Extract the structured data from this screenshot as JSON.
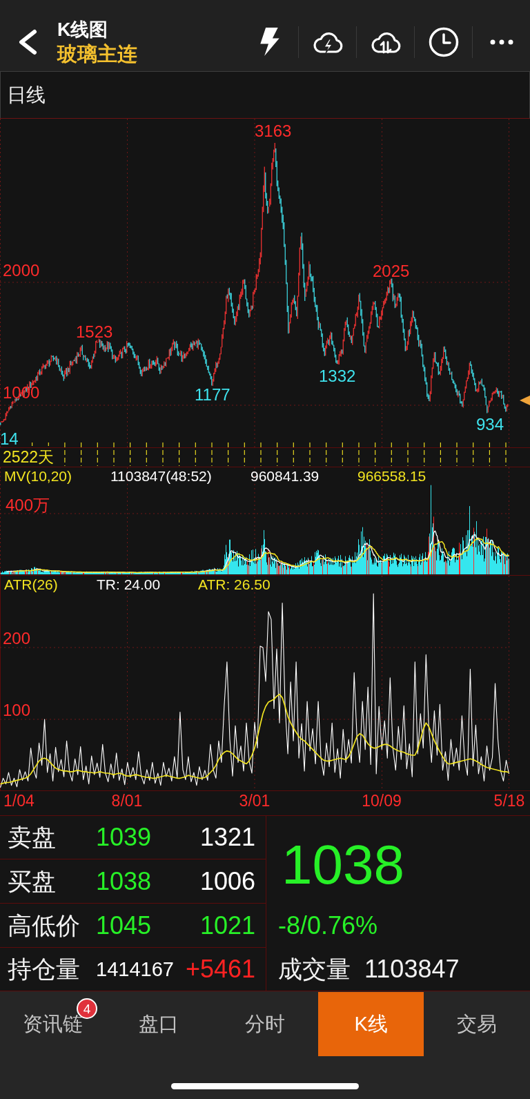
{
  "header": {
    "title": "K线图",
    "subtitle": "玻璃主连"
  },
  "period": {
    "label": "日线"
  },
  "price_chart": {
    "axis_labels": [
      "2000",
      "1000"
    ],
    "extremes": [
      {
        "text": "3163",
        "kind": "high"
      },
      {
        "text": "1523",
        "kind": "high"
      },
      {
        "text": "2025",
        "kind": "high"
      },
      {
        "text": "1177",
        "kind": "low"
      },
      {
        "text": "1332",
        "kind": "low"
      },
      {
        "text": "934",
        "kind": "low"
      },
      {
        "text": "14",
        "kind": "low"
      }
    ],
    "day_count": "2522天"
  },
  "volume_chart": {
    "legend": [
      {
        "text": "MV(10,20)",
        "color": "#f2e421"
      },
      {
        "text": "1103847(48:52)",
        "color": "#ffffff"
      },
      {
        "text": "960841.39",
        "color": "#ffffff"
      },
      {
        "text": "966558.15",
        "color": "#f2e421"
      }
    ],
    "axis_label": "400万"
  },
  "atr_chart": {
    "chart_data": {
      "type": "line",
      "title": "ATR(26)",
      "ylim": [
        0,
        300
      ],
      "yticks": [
        100,
        200
      ],
      "series": [
        {
          "name": "TR: 24.00",
          "color": "#ffffff",
          "values": [
            5,
            18,
            10,
            26,
            8,
            18,
            6,
            30,
            15,
            27,
            14,
            60,
            30,
            18,
            67,
            36,
            100,
            26,
            52,
            14,
            61,
            27,
            44,
            20,
            70,
            27,
            14,
            45,
            23,
            62,
            16,
            35,
            10,
            49,
            23,
            39,
            19,
            65,
            25,
            13,
            38,
            18,
            53,
            15,
            31,
            9,
            40,
            19,
            33,
            16,
            55,
            21,
            10,
            30,
            15,
            40,
            11,
            25,
            8,
            40,
            20,
            32,
            14,
            48,
            18,
            110,
            30,
            16,
            48,
            13,
            26,
            8,
            34,
            16,
            29,
            15,
            65,
            30,
            18,
            70,
            40,
            119,
            180,
            72,
            21,
            91,
            40,
            63,
            28,
            95,
            42,
            25,
            96,
            60,
            202,
            200,
            153,
            250,
            239,
            115,
            198,
            95,
            262,
            118,
            52,
            152,
            70,
            180,
            46,
            94,
            28,
            125,
            56,
            87,
            38,
            125,
            46,
            22,
            67,
            34,
            95,
            26,
            59,
            18,
            86,
            40,
            72,
            39,
            165,
            76,
            40,
            125,
            58,
            145,
            37,
            275,
            24,
            118,
            58,
            98,
            46,
            158,
            60,
            29,
            90,
            44,
            119,
            31,
            66,
            20,
            180,
            52,
            108,
            60,
            190,
            90,
            40,
            112,
            50,
            121,
            29,
            55,
            15,
            72,
            35,
            60,
            29,
            105,
            43,
            22,
            170,
            35,
            92,
            24,
            48,
            14,
            63,
            29,
            47,
            150,
            72,
            28,
            14,
            43,
            24
          ]
        },
        {
          "name": "ATR: 26.50",
          "color": "#f2e421",
          "values": [
            10,
            11,
            12,
            12,
            13,
            14,
            15,
            16,
            17,
            18,
            20,
            24,
            30,
            36,
            42,
            45,
            46,
            44,
            40,
            36,
            32,
            30,
            29,
            28,
            28,
            27,
            27,
            28,
            29,
            28,
            27,
            27,
            26,
            26,
            25,
            26,
            27,
            26,
            25,
            25,
            24,
            23,
            24,
            25,
            24,
            22,
            21,
            21,
            22,
            23,
            22,
            21,
            20,
            19,
            19,
            18,
            18,
            19,
            20,
            21,
            22,
            21,
            20,
            19,
            18,
            18,
            19,
            20,
            22,
            21,
            20,
            19,
            18,
            18,
            19,
            22,
            26,
            30,
            36,
            44,
            50,
            54,
            56,
            55,
            52,
            48,
            44,
            42,
            40,
            38,
            42,
            50,
            60,
            75,
            92,
            108,
            118,
            124,
            126,
            128,
            132,
            135,
            130,
            118,
            104,
            95,
            88,
            82,
            76,
            72,
            70,
            66,
            62,
            58,
            54,
            50,
            46,
            43,
            42,
            42,
            43,
            44,
            45,
            46,
            45,
            44,
            48,
            56,
            66,
            76,
            80,
            78,
            72,
            66,
            62,
            60,
            60,
            62,
            64,
            65,
            65,
            63,
            60,
            58,
            56,
            55,
            54,
            52,
            51,
            50,
            50,
            58,
            72,
            86,
            95,
            90,
            80,
            70,
            62,
            55,
            48,
            42,
            38,
            38,
            39,
            40,
            41,
            42,
            43,
            44,
            45,
            44,
            42,
            40,
            37,
            35,
            33,
            32,
            31,
            30,
            29,
            28,
            27,
            27,
            26
          ]
        }
      ]
    }
  },
  "date_axis": [
    "1/04",
    "8/01",
    "3/01",
    "10/09",
    "5/18"
  ],
  "quote": {
    "rows": [
      {
        "kind": "price",
        "label": "卖盘",
        "values": [
          {
            "text": "1039",
            "color": "#27f027"
          },
          {
            "text": "1321",
            "color": "#ffffff"
          }
        ]
      },
      {
        "kind": "price",
        "label": "买盘",
        "values": [
          {
            "text": "1038",
            "color": "#27f027"
          },
          {
            "text": "1006",
            "color": "#ffffff"
          }
        ]
      },
      {
        "kind": "price",
        "label": "高低价",
        "values": [
          {
            "text": "1045",
            "color": "#27f027"
          },
          {
            "text": "1021",
            "color": "#27f027"
          }
        ]
      },
      {
        "kind": "position",
        "label": "持仓量",
        "values": [
          {
            "text": "1414167",
            "color": "#ffffff"
          },
          {
            "text": "+5461",
            "color": "#ff2222"
          }
        ]
      }
    ],
    "last_price": {
      "text": "1038",
      "color": "#27f027"
    },
    "change": {
      "text": "-8/0.76%",
      "color": "#27f027"
    },
    "volume": {
      "label": "成交量",
      "value": "1103847"
    }
  },
  "tabs": [
    {
      "label": "资讯链",
      "selected": false,
      "badge": "4"
    },
    {
      "label": "盘口",
      "selected": false
    },
    {
      "label": "分时",
      "selected": false
    },
    {
      "label": "K线",
      "selected": true
    },
    {
      "label": "交易",
      "selected": false
    }
  ]
}
